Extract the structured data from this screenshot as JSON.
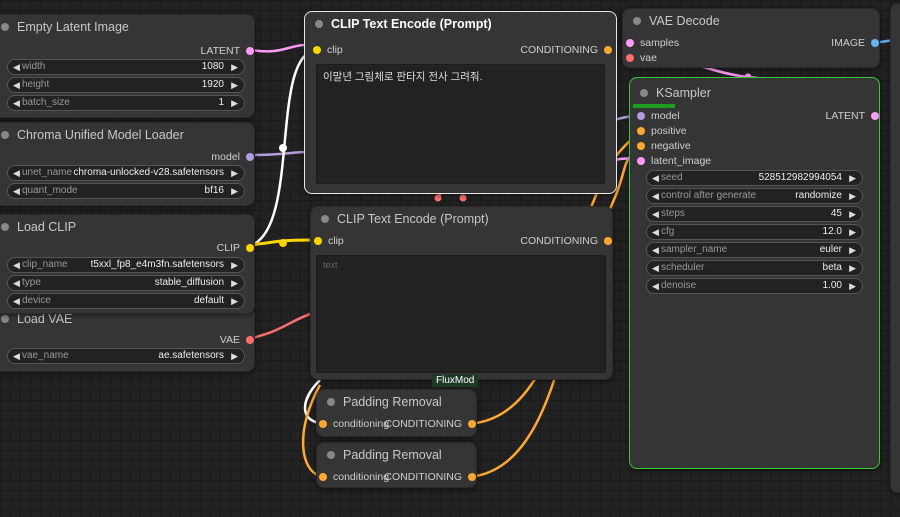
{
  "colors": {
    "latent": "#ff9cf9",
    "model": "#b39ddb",
    "clip": "#ffd500",
    "conditioning": "#ffa931",
    "vae": "#ff6e6e",
    "image": "#64b5f6",
    "running_border": "#34c934"
  },
  "nodes": {
    "empty_latent": {
      "title": "Empty Latent Image",
      "output": "LATENT",
      "widgets": [
        {
          "label": "width",
          "value": "1080"
        },
        {
          "label": "height",
          "value": "1920"
        },
        {
          "label": "batch_size",
          "value": "1"
        }
      ]
    },
    "chroma_loader": {
      "title": "Chroma Unified Model Loader",
      "output": "model",
      "widgets": [
        {
          "label": "unet_name",
          "value": "chroma-unlocked-v28.safetensors"
        },
        {
          "label": "quant_mode",
          "value": "bf16"
        }
      ]
    },
    "load_clip": {
      "title": "Load CLIP",
      "output": "CLIP",
      "widgets": [
        {
          "label": "clip_name",
          "value": "t5xxl_fp8_e4m3fn.safetensors"
        },
        {
          "label": "type",
          "value": "stable_diffusion"
        },
        {
          "label": "device",
          "value": "default"
        }
      ]
    },
    "load_vae": {
      "title": "Load VAE",
      "output": "VAE",
      "widgets": [
        {
          "label": "vae_name",
          "value": "ae.safetensors"
        }
      ]
    },
    "clip_text_pos": {
      "title": "CLIP Text Encode (Prompt)",
      "input": "clip",
      "output": "CONDITIONING",
      "text": "이말년 그림체로 판타지 전사 그려줘."
    },
    "clip_text_neg": {
      "title": "CLIP Text Encode (Prompt)",
      "input": "clip",
      "output": "CONDITIONING",
      "placeholder": "text",
      "badge": "FluxMod"
    },
    "padding_1": {
      "title": "Padding Removal",
      "input": "conditioning",
      "output": "CONDITIONING"
    },
    "padding_2": {
      "title": "Padding Removal",
      "input": "conditioning",
      "output": "CONDITIONING"
    },
    "vae_decode": {
      "title": "VAE Decode",
      "inputs": [
        "samples",
        "vae"
      ],
      "output": "IMAGE"
    },
    "ksampler": {
      "title": "KSampler",
      "inputs": [
        "model",
        "positive",
        "negative",
        "latent_image"
      ],
      "output": "LATENT",
      "progress": 0.17,
      "widgets": [
        {
          "label": "seed",
          "value": "528512982994054"
        },
        {
          "label": "control after generate",
          "value": "randomize"
        },
        {
          "label": "steps",
          "value": "45"
        },
        {
          "label": "cfg",
          "value": "12.0"
        },
        {
          "label": "sampler_name",
          "value": "euler"
        },
        {
          "label": "scheduler",
          "value": "beta"
        },
        {
          "label": "denoise",
          "value": "1.00"
        }
      ]
    }
  }
}
